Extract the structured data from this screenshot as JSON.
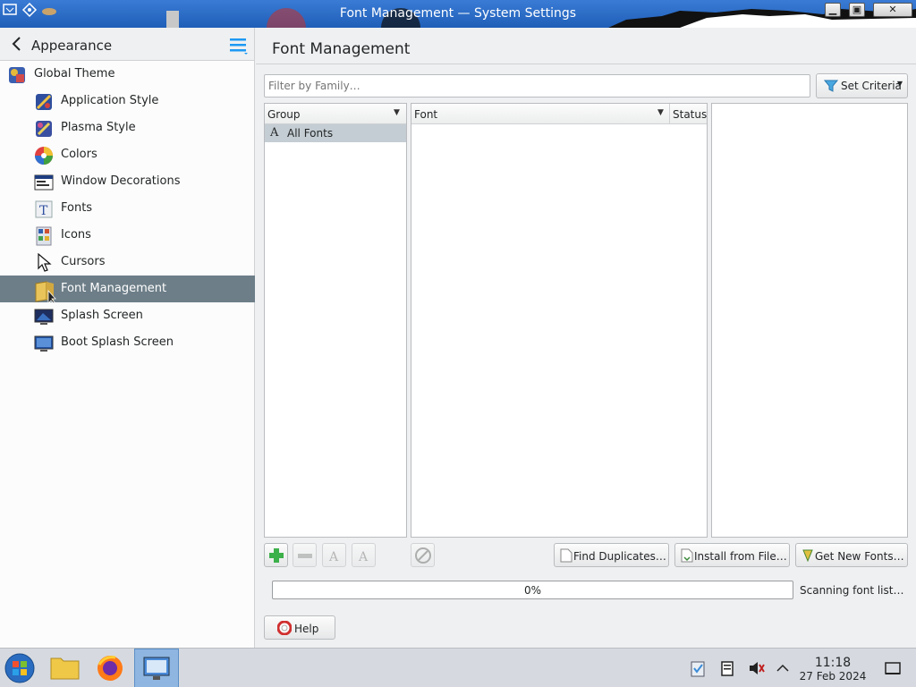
{
  "window": {
    "title": "Font Management — System Settings",
    "controls": {
      "minimize": "▁",
      "maximize": "▣",
      "close": "✕"
    }
  },
  "sidebar": {
    "header_title": "Appearance",
    "items": [
      {
        "label": "Global Theme",
        "icon": "global-theme-icon"
      },
      {
        "label": "Application Style",
        "icon": "application-style-icon"
      },
      {
        "label": "Plasma Style",
        "icon": "plasma-style-icon"
      },
      {
        "label": "Colors",
        "icon": "colors-icon"
      },
      {
        "label": "Window Decorations",
        "icon": "window-decorations-icon"
      },
      {
        "label": "Fonts",
        "icon": "fonts-icon"
      },
      {
        "label": "Icons",
        "icon": "icons-icon"
      },
      {
        "label": "Cursors",
        "icon": "cursor-icon"
      },
      {
        "label": "Font Management",
        "icon": "font-management-icon",
        "active": true
      },
      {
        "label": "Splash Screen",
        "icon": "splash-screen-icon"
      },
      {
        "label": "Boot Splash Screen",
        "icon": "boot-splash-screen-icon"
      }
    ]
  },
  "main": {
    "title": "Font Management",
    "filter_placeholder": "Filter by Family…",
    "set_criteria": "Set Criteria",
    "group_header": "Group",
    "group_items": [
      {
        "label": "All Fonts",
        "glyph": "A"
      }
    ],
    "font_header": "Font",
    "status_header": "Status",
    "buttons": {
      "find_duplicates": "Find Duplicates…",
      "install_from_file": "Install from File…",
      "get_new_fonts": "Get New Fonts…",
      "help": "Help"
    },
    "progress_percent": 0,
    "progress_text": "0%",
    "status_text": "Scanning font list…"
  },
  "taskbar": {
    "clock_time": "11:18",
    "clock_date": "27 Feb 2024"
  },
  "colors": {
    "accent": "#3daee9",
    "selection": "#6d7e88",
    "titlebar": "#2a6cc8"
  }
}
